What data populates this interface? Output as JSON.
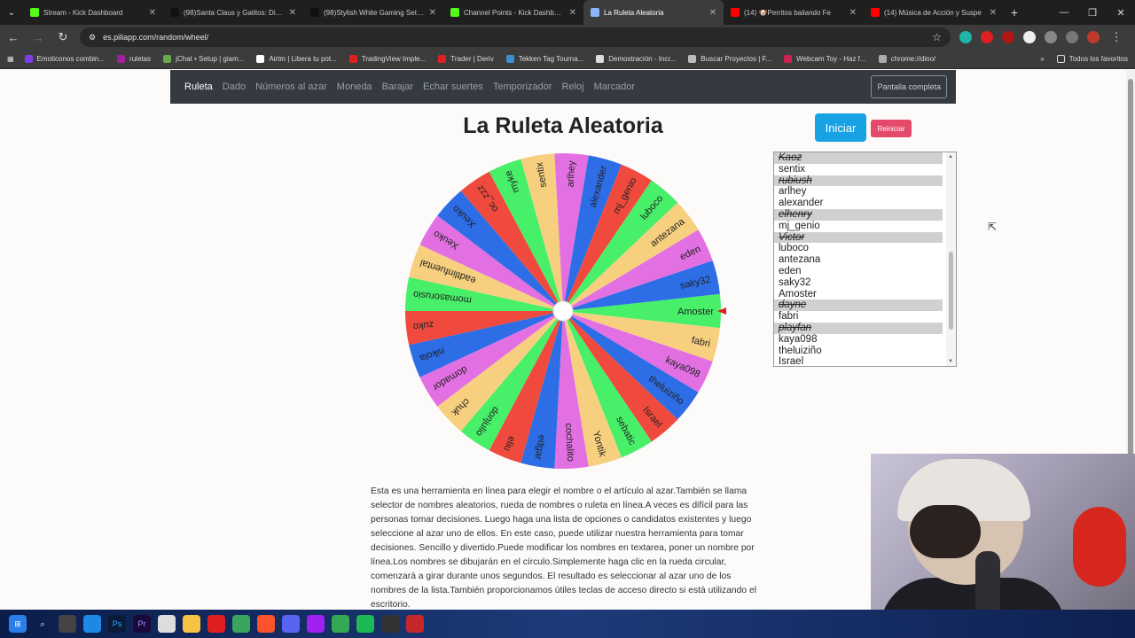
{
  "browser": {
    "tabs": [
      {
        "title": "Stream - Kick Dashboard",
        "color": "#53fc18",
        "active": false
      },
      {
        "title": "(98)Santa Claus y Gatitos: Diver",
        "color": "#111111",
        "active": false
      },
      {
        "title": "(98)Stylish White Gaming Setup",
        "color": "#111111",
        "active": false
      },
      {
        "title": "Channel Points - Kick Dashboard",
        "color": "#53fc18",
        "active": false
      },
      {
        "title": "La Ruleta Aleatoria",
        "color": "#8ab4f8",
        "active": true
      },
      {
        "title": "(14) 🐶Perritos bailando Fe",
        "color": "#ff0000",
        "active": false
      },
      {
        "title": "(14) Música de Acción y Suspe",
        "color": "#ff0000",
        "active": false
      }
    ],
    "url": "es.piliapp.com/random/wheel/",
    "bookmarks": [
      {
        "label": "Emoticonos combin...",
        "color": "#7b3fe4"
      },
      {
        "label": "ruletas",
        "color": "#a020a0"
      },
      {
        "label": "jChat • Setup | giam...",
        "color": "#6aa84f"
      },
      {
        "label": "Airtm | Libera tu pot...",
        "color": "#ffffff"
      },
      {
        "label": "TradingView Imple...",
        "color": "#e02020"
      },
      {
        "label": "Trader | Deriv",
        "color": "#e02020"
      },
      {
        "label": "Tekken Tag Tourna...",
        "color": "#3a8fd0"
      },
      {
        "label": "Demostración - Incr...",
        "color": "#dddddd"
      },
      {
        "label": "Buscar Proyectos | F...",
        "color": "#bbbbbb"
      },
      {
        "label": "Webcam Toy - Haz f...",
        "color": "#cc2255"
      },
      {
        "label": "chrome://dino/",
        "color": "#aaaaaa"
      }
    ],
    "all_bookmarks": "Todos los favoritos"
  },
  "site_nav": {
    "items": [
      "Ruleta",
      "Dado",
      "Números al azar",
      "Moneda",
      "Barajar",
      "Echar suertes",
      "Temporizador",
      "Reloj",
      "Marcador"
    ],
    "fullscreen": "Pantalla completa"
  },
  "heading": "La Ruleta Aleatoria",
  "buttons": {
    "start": "Iniciar",
    "reset": "Reiniciar"
  },
  "wheel": {
    "colors": [
      "#48f06a",
      "#f7d07f",
      "#e370e3",
      "#2d6de6",
      "#ef4a3d"
    ],
    "pointer_color": "#e81e1e",
    "segments": [
      "Amoster",
      "fabri",
      "kaya098",
      "theluiziño",
      "Israel",
      "sebatic",
      "Yontik",
      "cochalito",
      "edgar",
      "eliu",
      "donjulio",
      "chuk",
      "domador",
      "nikola",
      "zuko",
      "momasorusio",
      "eadtlinfuental",
      "Xeuko",
      "Xeuko",
      "oc_zzz",
      "myke",
      "sentix",
      "arlhey",
      "alexander",
      "mj_genio",
      "luboco",
      "antezana",
      "eden",
      "saky32"
    ]
  },
  "names_list": [
    {
      "name": "Kaoz",
      "struck": true
    },
    {
      "name": "sentix",
      "struck": false
    },
    {
      "name": "rubiush",
      "struck": true
    },
    {
      "name": "arlhey",
      "struck": false
    },
    {
      "name": "alexander",
      "struck": false
    },
    {
      "name": "elhenry",
      "struck": true
    },
    {
      "name": "mj_genio",
      "struck": false
    },
    {
      "name": "Victor",
      "struck": true
    },
    {
      "name": "luboco",
      "struck": false
    },
    {
      "name": "antezana",
      "struck": false
    },
    {
      "name": "eden",
      "struck": false
    },
    {
      "name": "saky32",
      "struck": false
    },
    {
      "name": "Amoster",
      "struck": false
    },
    {
      "name": "dayne",
      "struck": true
    },
    {
      "name": "fabri",
      "struck": false
    },
    {
      "name": "playfan",
      "struck": true
    },
    {
      "name": "kaya098",
      "struck": false
    },
    {
      "name": "theluiziño",
      "struck": false
    },
    {
      "name": "Israel",
      "struck": false
    }
  ],
  "description": "Esta es una herramienta en línea para elegir el nombre o el artículo al azar.También se llama selector de nombres aleatorios, rueda de nombres o ruleta en línea.A veces es difícil para las personas tomar decisiones. Luego haga una lista de opciones o candidatos existentes y luego seleccione al azar uno de ellos. En este caso, puede utilizar nuestra herramienta para tomar decisiones. Sencillo y divertido.Puede modificar los nombres en textarea, poner un nombre por línea.Los nombres se dibujarán en el círculo.Simplemente haga clic en la rueda circular, comenzará a girar durante unos segundos. El resultado es seleccionar al azar uno de los nombres de la lista.También proporcionamos útiles teclas de acceso directo si está utilizando el escritorio."
}
